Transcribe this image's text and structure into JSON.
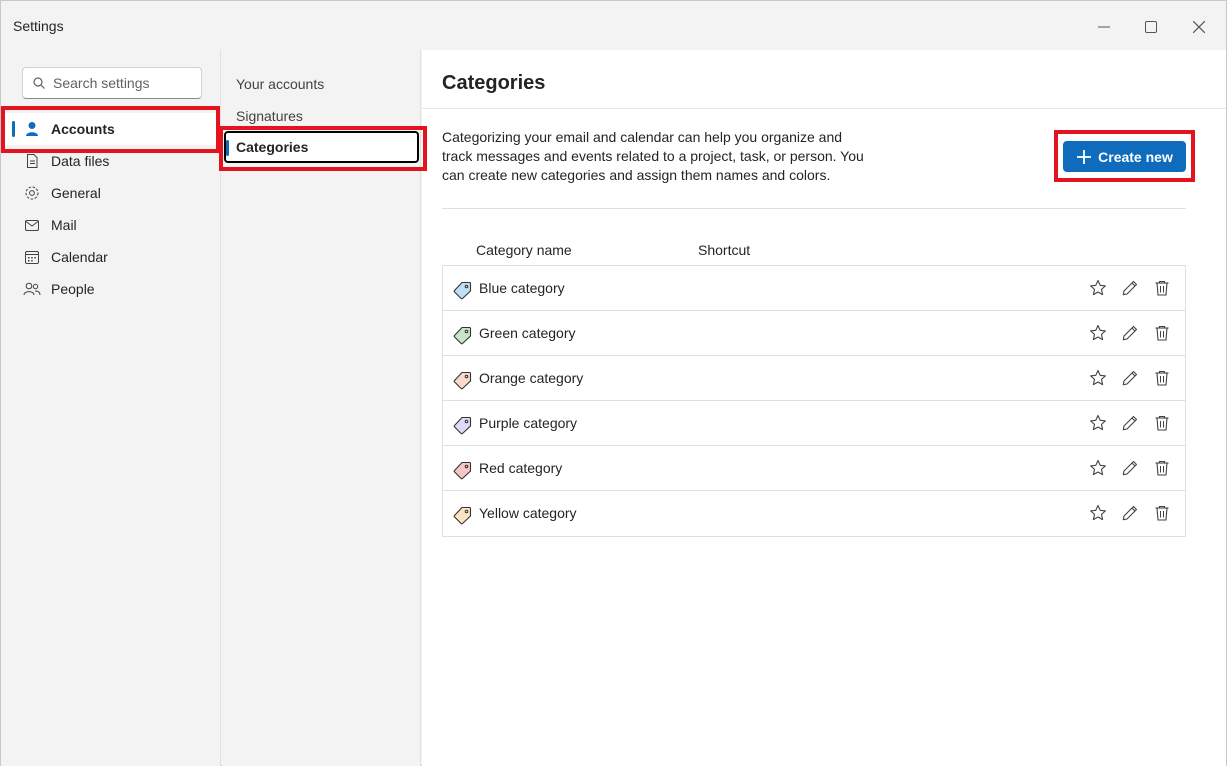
{
  "window": {
    "title": "Settings"
  },
  "search": {
    "placeholder": "Search settings"
  },
  "nav": {
    "items": [
      {
        "label": "Accounts",
        "icon": "person-icon",
        "selected": true
      },
      {
        "label": "Data files",
        "icon": "document-icon"
      },
      {
        "label": "General",
        "icon": "gear-icon"
      },
      {
        "label": "Mail",
        "icon": "mail-icon"
      },
      {
        "label": "Calendar",
        "icon": "calendar-icon"
      },
      {
        "label": "People",
        "icon": "people-icon"
      }
    ]
  },
  "subnav": {
    "items": [
      {
        "label": "Your accounts"
      },
      {
        "label": "Signatures"
      },
      {
        "label": "Categories",
        "selected": true
      }
    ]
  },
  "main": {
    "title": "Categories",
    "description": "Categorizing your email and calendar can help you organize and track messages and events related to a project, task, or person. You can create new categories and assign them names and colors.",
    "create_label": "Create new",
    "columns": {
      "name": "Category name",
      "shortcut": "Shortcut"
    },
    "categories": [
      {
        "name": "Blue category",
        "color": "#4aa3df"
      },
      {
        "name": "Green category",
        "color": "#5bb85d"
      },
      {
        "name": "Orange category",
        "color": "#f0946a"
      },
      {
        "name": "Purple category",
        "color": "#9a9ae0"
      },
      {
        "name": "Red category",
        "color": "#e8595b"
      },
      {
        "name": "Yellow category",
        "color": "#f0b35a"
      }
    ]
  },
  "colors": {
    "accent": "#0f6cbd",
    "highlight": "#e3141e"
  }
}
